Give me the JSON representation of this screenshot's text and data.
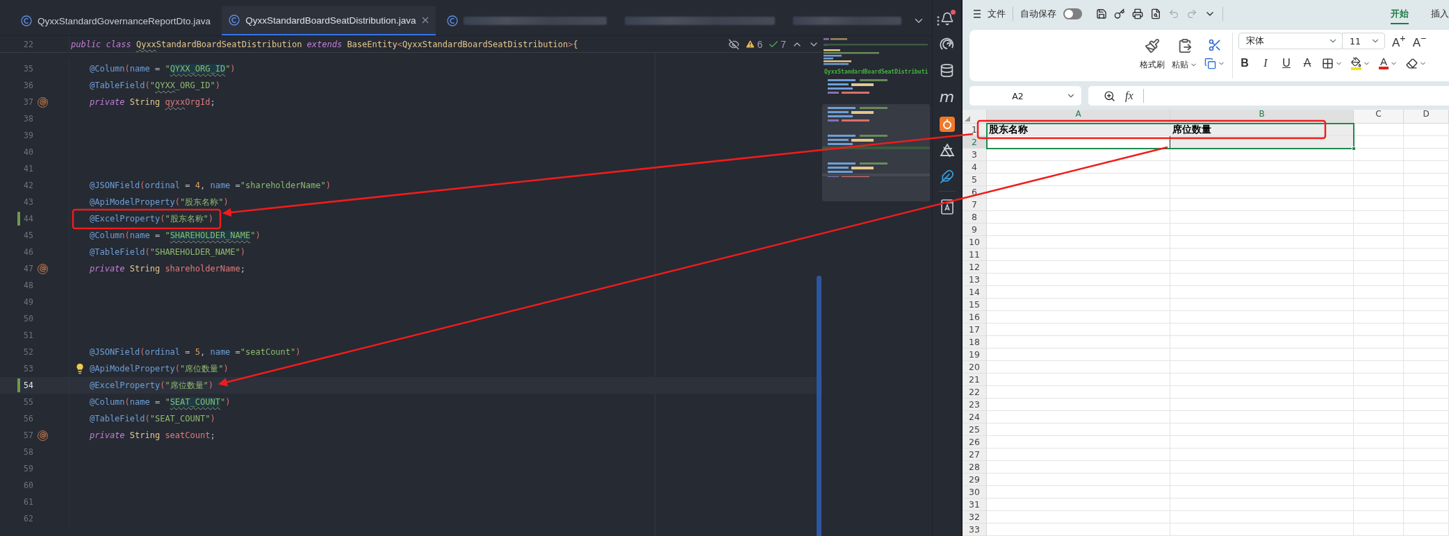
{
  "ide": {
    "tabs": [
      {
        "kind": "file",
        "label": "QyxxStandardGovernanceReportDto.java",
        "selected": false
      },
      {
        "kind": "file",
        "label": "QyxxStandardBoardSeatDistribution.java",
        "selected": true
      },
      {
        "kind": "partial",
        "selected": false
      },
      {
        "kind": "redacted",
        "selected": false
      },
      {
        "kind": "redacted",
        "selected": false
      }
    ],
    "sticky_line": {
      "number": "22",
      "tokens": [
        {
          "kind": "k",
          "text": "public "
        },
        {
          "kind": "k",
          "text": "class "
        },
        {
          "kind": "t",
          "text": "Qyxx",
          "typo": true
        },
        {
          "kind": "t",
          "text": "StandardBoardSeatDistribution"
        },
        {
          "kind": "k",
          "text": " extends "
        },
        {
          "kind": "t",
          "text": "BaseEntity"
        },
        {
          "kind": "p",
          "text": "<"
        },
        {
          "kind": "t",
          "text": "QyxxStandardBoardSeatDistribution"
        },
        {
          "kind": "p",
          "text": ">"
        },
        {
          "kind": "t",
          "text": "{"
        }
      ]
    },
    "inspections": {
      "warnings": "6",
      "passed": "7"
    },
    "lines": [
      {
        "number": "35",
        "kind": "plain",
        "changed": false,
        "current": false,
        "tokens": [
          {
            "kind": "an",
            "text": "@Column"
          },
          {
            "kind": "p",
            "text": "("
          },
          {
            "kind": "an",
            "text": "name"
          },
          {
            "kind": "x",
            "text": " = "
          },
          {
            "kind": "s",
            "text": "\""
          },
          {
            "kind": "s",
            "text": "QYXX_ORG_ID",
            "typo": true,
            "hl": true
          },
          {
            "kind": "s",
            "text": "\""
          },
          {
            "kind": "p",
            "text": ")"
          }
        ]
      },
      {
        "number": "36",
        "kind": "plain",
        "changed": false,
        "current": false,
        "tokens": [
          {
            "kind": "an",
            "text": "@TableField"
          },
          {
            "kind": "p",
            "text": "("
          },
          {
            "kind": "s",
            "text": "\""
          },
          {
            "kind": "s",
            "text": "QYXX",
            "typo": true
          },
          {
            "kind": "s",
            "text": "_ORG_ID\""
          },
          {
            "kind": "p",
            "text": ")"
          }
        ]
      },
      {
        "number": "37",
        "kind": "implemented",
        "changed": false,
        "current": false,
        "tokens": [
          {
            "kind": "k",
            "text": "private "
          },
          {
            "kind": "t",
            "text": "String "
          },
          {
            "kind": "f",
            "text": "qyxx",
            "typo": true
          },
          {
            "kind": "f",
            "text": "OrgId"
          },
          {
            "kind": "x",
            "text": ";"
          }
        ]
      },
      {
        "number": "38",
        "kind": "plain",
        "changed": false,
        "current": false
      },
      {
        "number": "39",
        "kind": "plain",
        "changed": false,
        "current": false
      },
      {
        "number": "40",
        "kind": "plain",
        "changed": false,
        "current": false
      },
      {
        "number": "41",
        "kind": "plain",
        "changed": false,
        "current": false
      },
      {
        "number": "42",
        "kind": "plain",
        "changed": false,
        "current": false,
        "tokens": [
          {
            "kind": "an",
            "text": "@JSONField"
          },
          {
            "kind": "p",
            "text": "("
          },
          {
            "kind": "an",
            "text": "ordinal"
          },
          {
            "kind": "x",
            "text": " = "
          },
          {
            "kind": "n",
            "text": "4"
          },
          {
            "kind": "x",
            "text": ", "
          },
          {
            "kind": "an",
            "text": "name"
          },
          {
            "kind": "x",
            "text": " ="
          },
          {
            "kind": "s",
            "text": "\"shareholderName\""
          },
          {
            "kind": "p",
            "text": ")"
          }
        ]
      },
      {
        "number": "43",
        "kind": "plain",
        "changed": false,
        "current": false,
        "tokens": [
          {
            "kind": "an",
            "text": "@ApiModelProperty"
          },
          {
            "kind": "p",
            "text": "("
          },
          {
            "kind": "s",
            "text": "\"股东名称\""
          },
          {
            "kind": "p",
            "text": ")"
          }
        ]
      },
      {
        "number": "44",
        "kind": "plain",
        "changed": true,
        "current": false,
        "tokens": [
          {
            "kind": "an",
            "text": "@ExcelProperty"
          },
          {
            "kind": "p",
            "text": "("
          },
          {
            "kind": "s",
            "text": "\"股东名称\""
          },
          {
            "kind": "p",
            "text": ")"
          }
        ]
      },
      {
        "number": "45",
        "kind": "plain",
        "changed": false,
        "current": false,
        "tokens": [
          {
            "kind": "an",
            "text": "@Column"
          },
          {
            "kind": "p",
            "text": "("
          },
          {
            "kind": "an",
            "text": "name"
          },
          {
            "kind": "x",
            "text": " = "
          },
          {
            "kind": "s",
            "text": "\""
          },
          {
            "kind": "s",
            "text": "SHAREHOLDER_NAME",
            "typo": true,
            "hl": true
          },
          {
            "kind": "s",
            "text": "\""
          },
          {
            "kind": "p",
            "text": ")"
          }
        ]
      },
      {
        "number": "46",
        "kind": "plain",
        "changed": false,
        "current": false,
        "tokens": [
          {
            "kind": "an",
            "text": "@TableField"
          },
          {
            "kind": "p",
            "text": "("
          },
          {
            "kind": "s",
            "text": "\"SHAREHOLDER_NAME\""
          },
          {
            "kind": "p",
            "text": ")"
          }
        ]
      },
      {
        "number": "47",
        "kind": "implemented",
        "changed": false,
        "current": false,
        "tokens": [
          {
            "kind": "k",
            "text": "private "
          },
          {
            "kind": "t",
            "text": "String "
          },
          {
            "kind": "f",
            "text": "shareholderName"
          },
          {
            "kind": "x",
            "text": ";"
          }
        ]
      },
      {
        "number": "48",
        "kind": "plain",
        "changed": false,
        "current": false
      },
      {
        "number": "49",
        "kind": "plain",
        "changed": false,
        "current": false
      },
      {
        "number": "50",
        "kind": "plain",
        "changed": false,
        "current": false
      },
      {
        "number": "51",
        "kind": "plain",
        "changed": false,
        "current": false
      },
      {
        "number": "52",
        "kind": "plain",
        "changed": false,
        "current": false,
        "tokens": [
          {
            "kind": "an",
            "text": "@JSONField"
          },
          {
            "kind": "p",
            "text": "("
          },
          {
            "kind": "an",
            "text": "ordinal"
          },
          {
            "kind": "x",
            "text": " = "
          },
          {
            "kind": "n",
            "text": "5"
          },
          {
            "kind": "x",
            "text": ", "
          },
          {
            "kind": "an",
            "text": "name"
          },
          {
            "kind": "x",
            "text": " ="
          },
          {
            "kind": "s",
            "text": "\"seatCount\""
          },
          {
            "kind": "p",
            "text": ")"
          }
        ]
      },
      {
        "number": "53",
        "kind": "intention",
        "changed": false,
        "current": false,
        "tokens": [
          {
            "kind": "an",
            "text": "@ApiModelProperty"
          },
          {
            "kind": "p",
            "text": "("
          },
          {
            "kind": "s",
            "text": "\"席位数量\""
          },
          {
            "kind": "p",
            "text": ")"
          }
        ]
      },
      {
        "number": "54",
        "kind": "plain",
        "changed": true,
        "current": true,
        "tokens": [
          {
            "kind": "an",
            "text": "@ExcelProperty"
          },
          {
            "kind": "p",
            "text": "("
          },
          {
            "kind": "s",
            "text": "\"席位数量\""
          },
          {
            "kind": "p",
            "text": ")"
          }
        ]
      },
      {
        "number": "55",
        "kind": "plain",
        "changed": false,
        "current": false,
        "tokens": [
          {
            "kind": "an",
            "text": "@Column"
          },
          {
            "kind": "p",
            "text": "("
          },
          {
            "kind": "an",
            "text": "name"
          },
          {
            "kind": "x",
            "text": " = "
          },
          {
            "kind": "s",
            "text": "\""
          },
          {
            "kind": "s",
            "text": "SEAT_COUNT",
            "typo": true,
            "hl": true
          },
          {
            "kind": "s",
            "text": "\""
          },
          {
            "kind": "p",
            "text": ")"
          }
        ]
      },
      {
        "number": "56",
        "kind": "plain",
        "changed": false,
        "current": false,
        "tokens": [
          {
            "kind": "an",
            "text": "@TableField"
          },
          {
            "kind": "p",
            "text": "("
          },
          {
            "kind": "s",
            "text": "\"SEAT_COUNT\""
          },
          {
            "kind": "p",
            "text": ")"
          }
        ]
      },
      {
        "number": "57",
        "kind": "implemented",
        "changed": false,
        "current": false,
        "tokens": [
          {
            "kind": "k",
            "text": "private "
          },
          {
            "kind": "t",
            "text": "String "
          },
          {
            "kind": "f",
            "text": "seatCount"
          },
          {
            "kind": "x",
            "text": ";"
          }
        ]
      },
      {
        "number": "58",
        "kind": "plain",
        "changed": false,
        "current": false
      },
      {
        "number": "59",
        "kind": "plain",
        "changed": false,
        "current": false
      },
      {
        "number": "60",
        "kind": "plain",
        "changed": false,
        "current": false
      },
      {
        "number": "61",
        "kind": "plain",
        "changed": false,
        "current": false
      },
      {
        "number": "62",
        "kind": "plain",
        "changed": false,
        "current": false
      }
    ],
    "minimap": {
      "title": "QyxxStandardBoardSeatDistributi"
    },
    "toolbar": {
      "maven_glyph": "m",
      "notifications_unread": true
    }
  },
  "sheet": {
    "menu_label": "文件",
    "autosave_label": "自动保存",
    "autosave_on": false,
    "tabs": [
      {
        "label": "开始",
        "selected": true
      },
      {
        "label": "插入",
        "selected": false
      }
    ],
    "ribbon": {
      "format_painter": "格式刷",
      "paste": "粘贴",
      "font": "宋体",
      "size": "11",
      "grow": "A$^{+}$",
      "shrink": "A$^{−}$",
      "format_buttons": [
        {
          "kind": "bold",
          "label": "B"
        },
        {
          "kind": "italic",
          "label": "I"
        },
        {
          "kind": "underline",
          "label": "U"
        },
        {
          "kind": "strike",
          "label": "A"
        }
      ],
      "font_color_label": "A"
    },
    "name_box": "A2",
    "fx": "fx",
    "columns": [
      {
        "label": "A",
        "selected": true
      },
      {
        "label": "B",
        "selected": true
      },
      {
        "label": "C",
        "selected": false
      },
      {
        "label": "D",
        "selected": false
      }
    ],
    "rows": [
      {
        "label": "1",
        "selected": false,
        "cells": [
          {
            "text": "股东名称",
            "selected": true,
            "active": false
          },
          {
            "text": "席位数量",
            "selected": true,
            "active": false
          },
          {
            "selected": false,
            "active": false
          },
          {
            "selected": false,
            "active": false
          }
        ]
      },
      {
        "label": "2",
        "selected": true,
        "cells": [
          {
            "selected": true,
            "active": true
          },
          {
            "selected": true,
            "active": false
          },
          {
            "selected": false,
            "active": false
          },
          {
            "selected": false,
            "active": false
          }
        ]
      },
      {
        "label": "3",
        "selected": false
      },
      {
        "label": "4",
        "selected": false
      },
      {
        "label": "5",
        "selected": false
      },
      {
        "label": "6",
        "selected": false
      },
      {
        "label": "7",
        "selected": false
      },
      {
        "label": "8",
        "selected": false
      },
      {
        "label": "9",
        "selected": false
      },
      {
        "label": "10",
        "selected": false
      },
      {
        "label": "11",
        "selected": false
      },
      {
        "label": "12",
        "selected": false
      },
      {
        "label": "13",
        "selected": false
      },
      {
        "label": "14",
        "selected": false
      },
      {
        "label": "15",
        "selected": false
      },
      {
        "label": "16",
        "selected": false
      },
      {
        "label": "17",
        "selected": false
      },
      {
        "label": "18",
        "selected": false
      },
      {
        "label": "19",
        "selected": false
      },
      {
        "label": "20",
        "selected": false
      },
      {
        "label": "21",
        "selected": false
      },
      {
        "label": "22",
        "selected": false
      },
      {
        "label": "23",
        "selected": false
      },
      {
        "label": "24",
        "selected": false
      },
      {
        "label": "25",
        "selected": false
      },
      {
        "label": "26",
        "selected": false
      },
      {
        "label": "27",
        "selected": false
      },
      {
        "label": "28",
        "selected": false
      },
      {
        "label": "29",
        "selected": false
      },
      {
        "label": "30",
        "selected": false
      },
      {
        "label": "31",
        "selected": false
      },
      {
        "label": "32",
        "selected": false
      },
      {
        "label": "33",
        "selected": false
      }
    ]
  }
}
